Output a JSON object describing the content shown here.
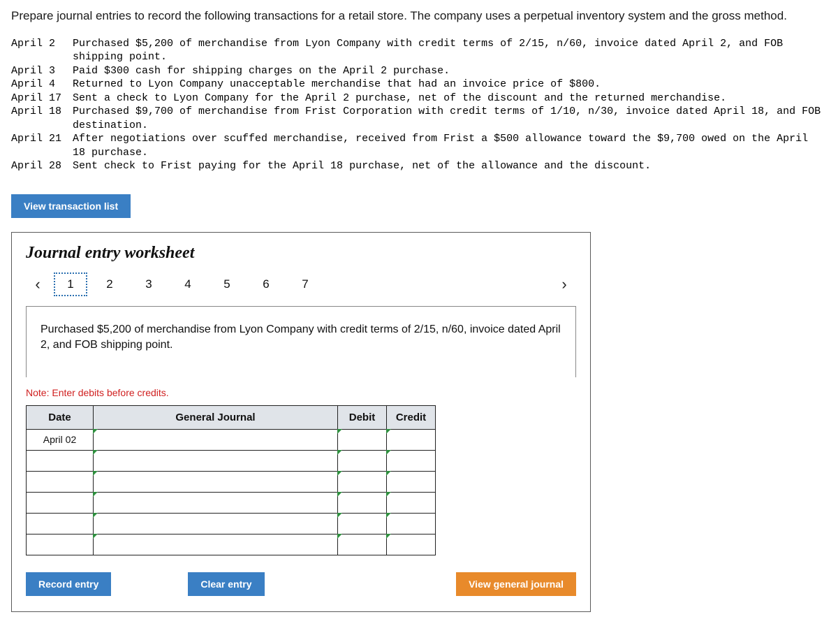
{
  "instructions": "Prepare journal entries to record the following transactions for a retail store. The company uses a perpetual inventory system and the gross method.",
  "transactions": [
    {
      "date": "April 2",
      "text": "Purchased $5,200 of merchandise from Lyon Company with credit terms of 2/15, n/60, invoice dated April 2, and FOB shipping point."
    },
    {
      "date": "April 3",
      "text": "Paid $300 cash for shipping charges on the April 2 purchase."
    },
    {
      "date": "April 4",
      "text": "Returned to Lyon Company unacceptable merchandise that had an invoice price of $800."
    },
    {
      "date": "April 17",
      "text": "Sent a check to Lyon Company for the April 2 purchase, net of the discount and the returned merchandise."
    },
    {
      "date": "April 18",
      "text": "Purchased $9,700 of merchandise from Frist Corporation with credit terms of 1/10, n/30, invoice dated April 18, and FOB destination."
    },
    {
      "date": "April 21",
      "text": "After negotiations over scuffed merchandise, received from Frist a $500 allowance toward the $9,700 owed on the April 18 purchase."
    },
    {
      "date": "April 28",
      "text": "Sent check to Frist paying for the April 18 purchase, net of the allowance and the discount."
    }
  ],
  "buttons": {
    "view_tx_list": "View transaction list",
    "record_entry": "Record entry",
    "clear_entry": "Clear entry",
    "view_general_journal": "View general journal"
  },
  "worksheet": {
    "title": "Journal entry worksheet",
    "tabs": [
      "1",
      "2",
      "3",
      "4",
      "5",
      "6",
      "7"
    ],
    "active_tab": "1",
    "description": "Purchased $5,200 of merchandise from Lyon Company with credit terms of 2/15, n/60, invoice dated April 2, and FOB shipping point.",
    "note": "Note: Enter debits before credits.",
    "headers": {
      "date": "Date",
      "gj": "General Journal",
      "debit": "Debit",
      "credit": "Credit"
    },
    "rows": [
      {
        "date": "April 02",
        "gj": "",
        "debit": "",
        "credit": ""
      },
      {
        "date": "",
        "gj": "",
        "debit": "",
        "credit": ""
      },
      {
        "date": "",
        "gj": "",
        "debit": "",
        "credit": ""
      },
      {
        "date": "",
        "gj": "",
        "debit": "",
        "credit": ""
      },
      {
        "date": "",
        "gj": "",
        "debit": "",
        "credit": ""
      },
      {
        "date": "",
        "gj": "",
        "debit": "",
        "credit": ""
      }
    ]
  }
}
